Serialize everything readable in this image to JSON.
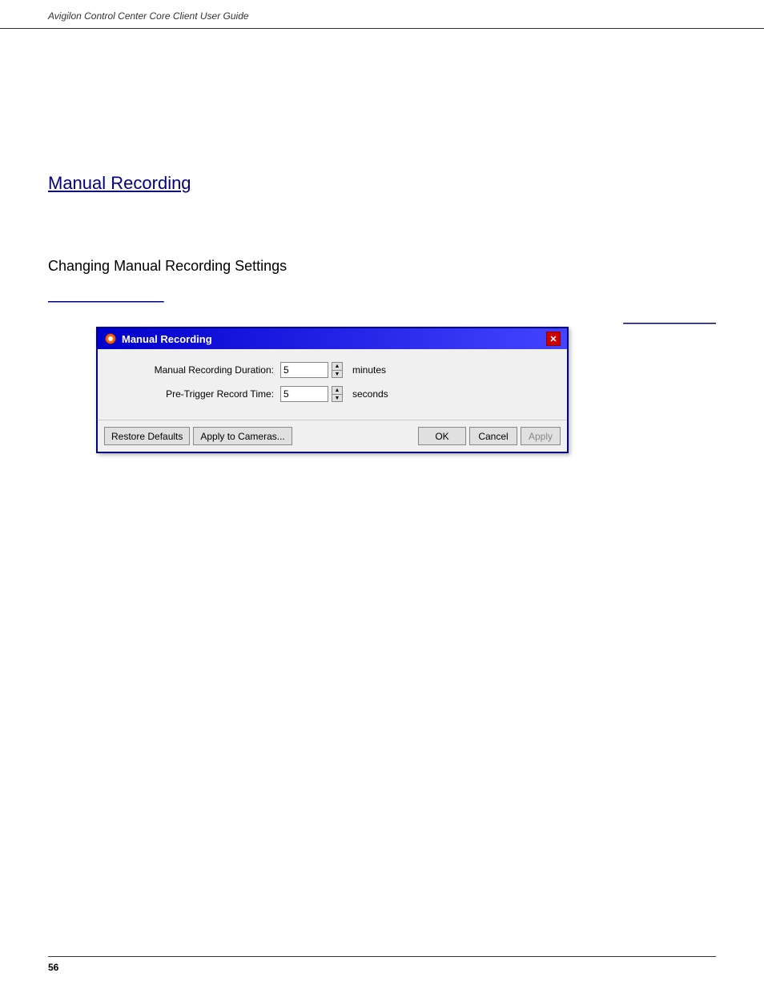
{
  "header": {
    "title": "Avigilon Control Center Core Client User Guide"
  },
  "section1": {
    "heading": "Manual Recording"
  },
  "topRightLink": {
    "text": "________________"
  },
  "section2": {
    "heading": "Changing Manual Recording Settings"
  },
  "underlineRef": {
    "text": "____________________"
  },
  "dialog": {
    "title": "Manual Recording",
    "close_label": "✕",
    "fields": [
      {
        "label": "Manual Recording Duration:",
        "value": "5",
        "unit": "minutes"
      },
      {
        "label": "Pre-Trigger Record Time:",
        "value": "5",
        "unit": "seconds"
      }
    ],
    "buttons": {
      "restore_defaults": "Restore Defaults",
      "apply_to_cameras": "Apply to Cameras...",
      "ok": "OK",
      "cancel": "Cancel",
      "apply": "Apply"
    }
  },
  "footer": {
    "page_number": "56"
  }
}
